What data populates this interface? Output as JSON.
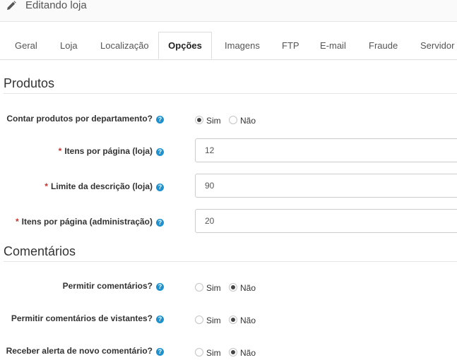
{
  "header": {
    "title": "Editando loja",
    "icon": "pencil-icon"
  },
  "tabs": [
    {
      "label": "Geral",
      "active": false
    },
    {
      "label": "Loja",
      "active": false
    },
    {
      "label": "Localização",
      "active": false
    },
    {
      "label": "Opções",
      "active": true
    },
    {
      "label": "Imagens",
      "active": false
    },
    {
      "label": "FTP",
      "active": false
    },
    {
      "label": "E-mail",
      "active": false
    },
    {
      "label": "Fraude",
      "active": false
    },
    {
      "label": "Servidor",
      "active": false
    }
  ],
  "sections": {
    "produtos": {
      "title": "Produtos",
      "contar": {
        "label": "Contar produtos por departamento?",
        "selected": "Sim"
      },
      "itens_loja": {
        "label": "Itens por página (loja)",
        "value": "12",
        "required": true
      },
      "limite_descricao": {
        "label": "Limite da descrição (loja)",
        "value": "90",
        "required": true
      },
      "itens_admin": {
        "label": "Itens por página (administração)",
        "value": "20",
        "required": true
      }
    },
    "comentarios": {
      "title": "Comentários",
      "permitir": {
        "label": "Permitir comentários?",
        "selected": "Não"
      },
      "visitantes": {
        "label": "Permitir comentários de vistantes?",
        "selected": "Não"
      },
      "alerta": {
        "label": "Receber alerta de novo comentário?",
        "selected": "Não"
      }
    }
  },
  "options": {
    "yes": "Sim",
    "no": "Não"
  },
  "required_mark": "*",
  "help_glyph": "?",
  "colors": {
    "accent": "#1e91cf",
    "required": "#c9302c",
    "border": "#dddddd"
  }
}
